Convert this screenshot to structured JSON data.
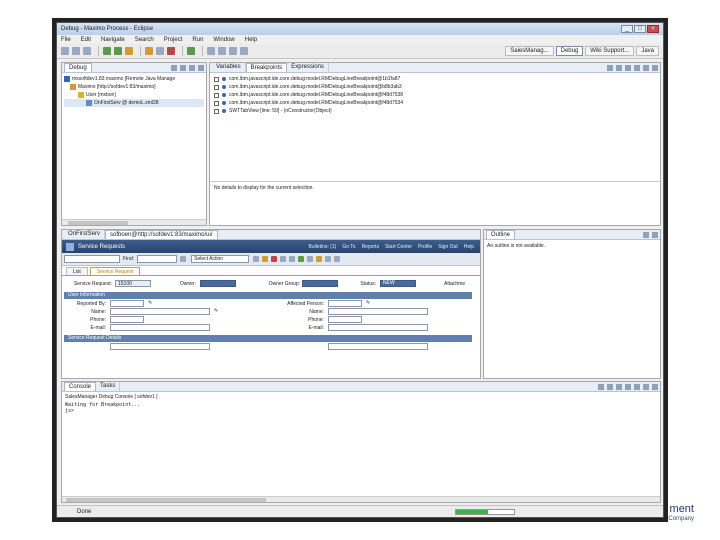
{
  "footer": {
    "line1": "ment",
    "line2": "A Consulting and Technology Company"
  },
  "window": {
    "title": "Debug - Maximo Process - Eclipse",
    "menu": [
      "File",
      "Edit",
      "Navigate",
      "Search",
      "Project",
      "Run",
      "Window",
      "Help"
    ],
    "perspectives": [
      "SalesManag...",
      "Debug",
      "Wiki Support...",
      "Java"
    ]
  },
  "debug_view": {
    "tab": "Debug",
    "tree": [
      "mxsoftdev1.83 maximo [Remote Java Manage",
      "Maximo [http://sofdev1:83/maximo]",
      "User [mxbon]",
      "OnFirstServ @ demoL.xml28"
    ]
  },
  "breakpoints_view": {
    "tabs": [
      "Variables",
      "Breakpoints",
      "Expressions"
    ],
    "rows": [
      "com.ibm.javascript.ide.core.debug.model.RMDebugLineBreakpoint@1b1fa87",
      "com.ibm.javascript.ide.core.debug.model.RMDebugLineBreakpoint@b8b3ab3",
      "com.ibm.javascript.ide.core.debug.model.RMDebugLineBreakpoint@f48d7538",
      "com.ibm.javascript.ide.core.debug.model.RMDebugLineBreakpoint@f48d7534",
      "SWTTabView [line: 59] - (nConstructor(Object)"
    ],
    "details": "No details to display for the current selection."
  },
  "editor": {
    "tabs": [
      "OnFirstServ",
      "sofboen@http://sofdev1:83/maximo/ui/"
    ],
    "header_title": "Service Requests",
    "header_links": [
      "Bulletins: (1)",
      "Go To",
      "Reports",
      "Start Center",
      "Profile",
      "Sign Out",
      "Help"
    ],
    "find_label": "Find:",
    "select_action": "Select Action",
    "subtabs": [
      "List",
      "Service Request"
    ],
    "service_request_label": "Service Request:",
    "service_request_value": "15100",
    "owner_label": "Owner:",
    "owner_group_label": "Owner Group:",
    "status_label": "Status:",
    "status_value": "NEW",
    "attachments_label": "Attachme",
    "user_info_title": "User Information",
    "left_fields": [
      "Reported By:",
      "Name:",
      "Phone:",
      "E-mail:"
    ],
    "right_fields": [
      "Affected Person:",
      "Name:",
      "Phone:",
      "E-mail:"
    ],
    "details_title": "Service Request Details"
  },
  "outline": {
    "tab": "Outline",
    "message": "An outline is not available."
  },
  "console": {
    "tabs": [
      "Console",
      "Tasks"
    ],
    "source": "SalesManager Debug Console [ sofdev1 ]",
    "line1": "Waiting for Breakpoint...",
    "line2": "js>"
  },
  "status_bar": {
    "text": "Done",
    "progress": 0.55
  }
}
